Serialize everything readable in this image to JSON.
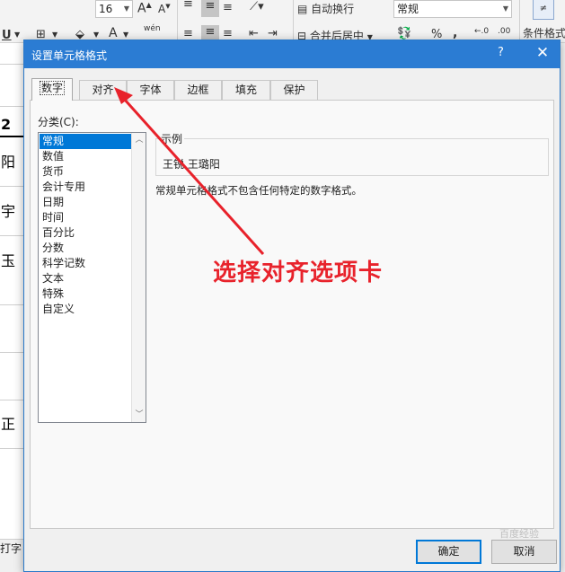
{
  "ribbon": {
    "font_size": "16",
    "grow_font_glyph": "A",
    "shrink_font_glyph": "A",
    "underline": "U",
    "font_color_glyph": "A",
    "phonetic": "wén",
    "wrap_text": "自动换行",
    "merge_center": "合并后居中",
    "number_format": "常规",
    "percent": "%",
    "comma": ",",
    "cond_format": "条件格式"
  },
  "sheet": {
    "cells": [
      "2",
      "阳",
      "宇",
      "玉",
      "",
      "",
      "正"
    ],
    "status": "打字"
  },
  "dialog": {
    "title": "设置单元格格式",
    "help": "?",
    "close": "✕",
    "tabs": [
      {
        "label": "数字",
        "active": true
      },
      {
        "label": "对齐",
        "active": false
      },
      {
        "label": "字体",
        "active": false
      },
      {
        "label": "边框",
        "active": false
      },
      {
        "label": "填充",
        "active": false
      },
      {
        "label": "保护",
        "active": false
      }
    ],
    "category_label": "分类(C):",
    "categories": [
      "常规",
      "数值",
      "货币",
      "会计专用",
      "日期",
      "时间",
      "百分比",
      "分数",
      "科学记数",
      "文本",
      "特殊",
      "自定义"
    ],
    "selected_category": "常规",
    "sample_label": "示例",
    "sample_value": "王锐 王璐阳",
    "description": "常规单元格格式不包含任何特定的数字格式。",
    "ok": "确定",
    "cancel": "取消"
  },
  "annotation": {
    "callout": "选择对齐选项卡",
    "color": "#e8222b"
  },
  "watermark": "百度经验"
}
